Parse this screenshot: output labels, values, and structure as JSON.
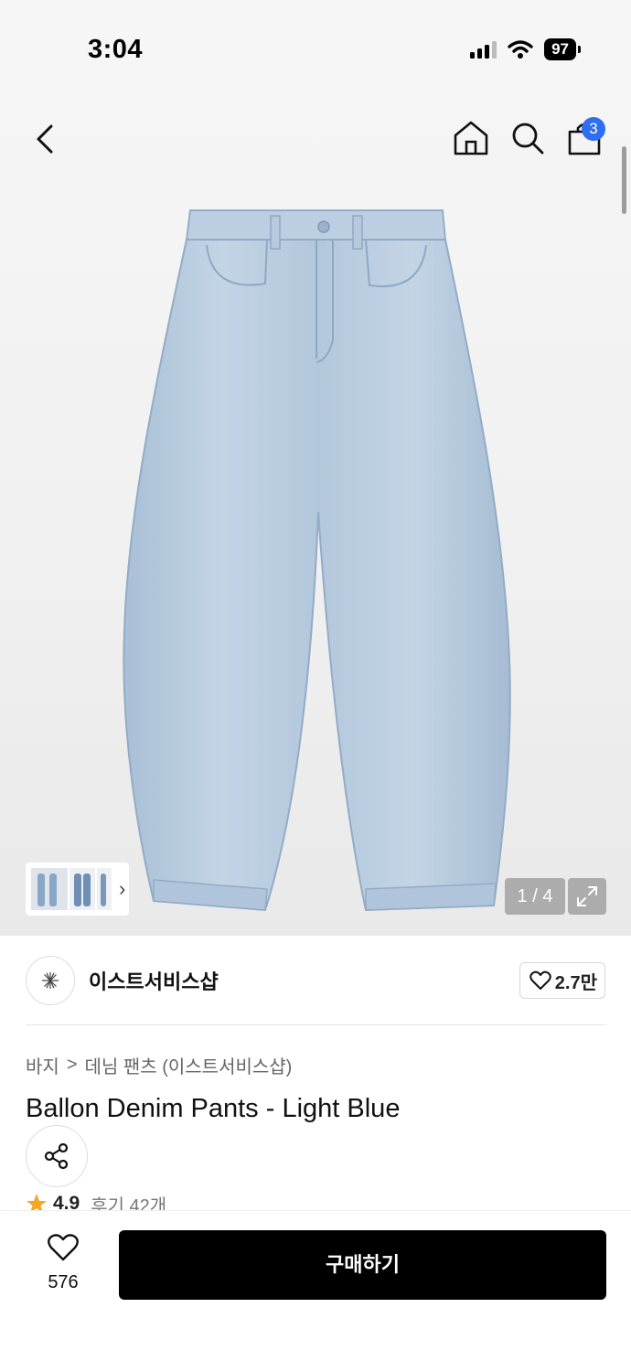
{
  "status_bar": {
    "time": "3:04",
    "battery": "97"
  },
  "nav": {
    "cart_count": "3"
  },
  "gallery": {
    "page_counter": "1 / 4"
  },
  "brand": {
    "name": "이스트서비스샵",
    "likes": "2.7만"
  },
  "breadcrumb": {
    "category": "바지",
    "separator": ">",
    "subcategory": "데님 팬츠 (이스트서비스샵)"
  },
  "product": {
    "title": "Ballon Denim Pants - Light Blue",
    "rating": "4.9",
    "reviews": "후기 42개"
  },
  "bottom": {
    "wish_count": "576",
    "buy_label": "구매하기"
  },
  "colors": {
    "accent_blue": "#2f6ef0",
    "denim": "#b9cde0",
    "buy_button": "#000000",
    "star": "#f5a623"
  },
  "icons": [
    "back-icon",
    "home-icon",
    "search-icon",
    "cart-icon",
    "expand-icon",
    "heart-icon",
    "share-icon",
    "star-icon"
  ]
}
